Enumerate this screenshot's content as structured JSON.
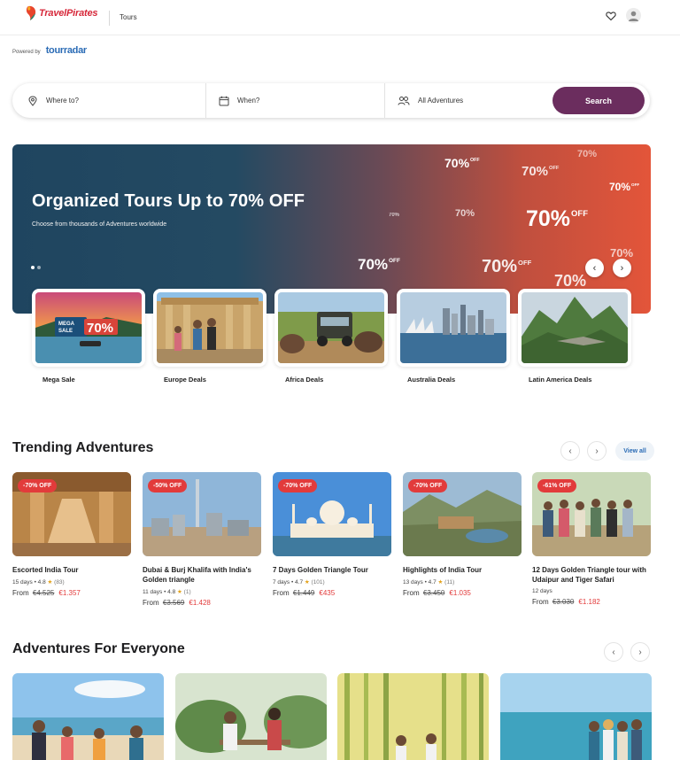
{
  "header": {
    "logo_text": "TravelPirates",
    "section": "Tours",
    "icons": {
      "favorites": "heart-icon",
      "account": "user-icon"
    }
  },
  "powered": {
    "label": "Powered by",
    "brand": "tourradar"
  },
  "search": {
    "where_placeholder": "Where to?",
    "when_placeholder": "When?",
    "adventures_value": "All Adventures",
    "button": "Search"
  },
  "hero": {
    "title": "Organized Tours Up to 70% OFF",
    "subtitle": "Choose from thousands of Adventures worldwide",
    "badge_text": "70%",
    "badge_off": "OFF"
  },
  "deals": [
    {
      "label": "Mega Sale",
      "overlay_line1": "MEGA",
      "overlay_line2": "SALE",
      "overlay_value": "70%"
    },
    {
      "label": "Europe Deals"
    },
    {
      "label": "Africa Deals"
    },
    {
      "label": "Australia Deals"
    },
    {
      "label": "Latin America Deals"
    }
  ],
  "trending": {
    "title": "Trending Adventures",
    "view_all": "View all",
    "cards": [
      {
        "discount": "-70% OFF",
        "title": "Escorted India Tour",
        "meta_pre": "15 days • 4.8",
        "reviews": "(83)",
        "from": "From",
        "old_price": "€4.525",
        "new_price": "€1.357"
      },
      {
        "discount": "-50% OFF",
        "title": "Dubai & Burj Khalifa with India's Golden triangle",
        "meta_pre": "11 days • 4.8",
        "reviews": "(1)",
        "from": "From",
        "old_price": "€3.569",
        "new_price": "€1.428"
      },
      {
        "discount": "-70% OFF",
        "title": "7 Days Golden Triangle Tour",
        "meta_pre": "7 days • 4.7",
        "reviews": "(101)",
        "from": "From",
        "old_price": "€1.449",
        "new_price": "€435"
      },
      {
        "discount": "-70% OFF",
        "title": "Highlights of India Tour",
        "meta_pre": "13 days • 4.7",
        "reviews": "(11)",
        "from": "From",
        "old_price": "€3.450",
        "new_price": "€1.035"
      },
      {
        "discount": "-61% OFF",
        "title": "12 Days Golden Triangle tour with Udaipur and Tiger Safari",
        "meta_pre": "12 days",
        "reviews": "",
        "from": "From",
        "old_price": "€3.030",
        "new_price": "€1.182"
      }
    ]
  },
  "everyone": {
    "title": "Adventures For Everyone"
  },
  "colors": {
    "brand": "#d6283a",
    "search_button": "#6b2d5e",
    "discount": "#e23b3b",
    "link": "#2a6bb5"
  }
}
